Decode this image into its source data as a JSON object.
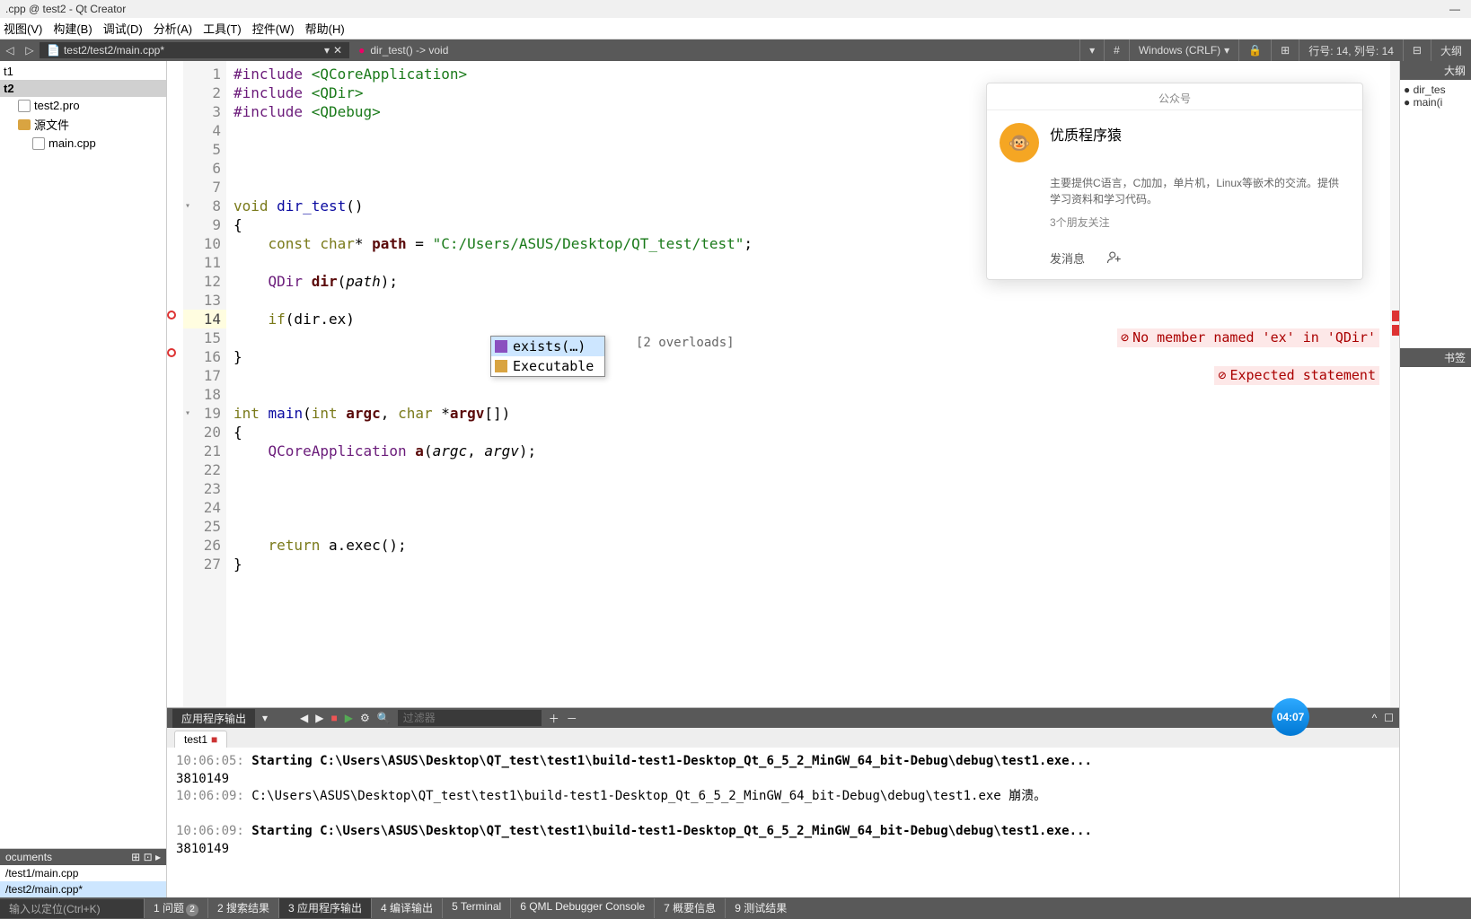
{
  "title": ".cpp @ test2 - Qt Creator",
  "menu": [
    "视图(V)",
    "构建(B)",
    "调试(D)",
    "分析(A)",
    "工具(T)",
    "控件(W)",
    "帮助(H)"
  ],
  "tab_path": "test2/test2/main.cpp*",
  "breadcrumb": "dir_test() -> void",
  "toolbar_status": {
    "encoding": "Windows (CRLF)",
    "pos": "行号: 14, 列号: 14",
    "outline_btn": "大纲"
  },
  "project_tree": [
    {
      "label": "t1",
      "indent": 0
    },
    {
      "label": "t2",
      "indent": 0,
      "bold": true,
      "sel": true
    },
    {
      "label": "test2.pro",
      "indent": 1,
      "icon": "file"
    },
    {
      "label": "源文件",
      "indent": 1,
      "icon": "folder"
    },
    {
      "label": "main.cpp",
      "indent": 2,
      "icon": "file"
    }
  ],
  "documents_header": "ocuments",
  "documents": [
    {
      "label": "/test1/main.cpp"
    },
    {
      "label": "/test2/main.cpp*",
      "sel": true
    }
  ],
  "code_lines": [
    {
      "n": 1,
      "html": "<span class='pp'>#include</span> <span class='inc'>&lt;QCoreApplication&gt;</span>"
    },
    {
      "n": 2,
      "html": "<span class='pp'>#include</span> <span class='inc'>&lt;QDir&gt;</span>"
    },
    {
      "n": 3,
      "html": "<span class='pp'>#include</span> <span class='inc'>&lt;QDebug&gt;</span>"
    },
    {
      "n": 4,
      "html": ""
    },
    {
      "n": 5,
      "html": ""
    },
    {
      "n": 6,
      "html": ""
    },
    {
      "n": 7,
      "html": ""
    },
    {
      "n": 8,
      "fold": true,
      "html": "<span class='kw'>void</span> <span class='fn'>dir_test</span>()"
    },
    {
      "n": 9,
      "html": "{"
    },
    {
      "n": 10,
      "html": "    <span class='kw'>const</span> <span class='kw'>char</span>* <span class='var'>path</span> = <span class='st'>\"C:/Users/ASUS/Desktop/QT_test/test\"</span>;"
    },
    {
      "n": 11,
      "html": ""
    },
    {
      "n": 12,
      "html": "    <span class='ty'>QDir</span> <span class='var'>dir</span>(<span class='it'>path</span>);"
    },
    {
      "n": 13,
      "html": ""
    },
    {
      "n": 14,
      "cur": true,
      "err": true,
      "html": "    <span class='kw'>if</span>(dir.ex)",
      "diag": "No member named 'ex' in 'QDir'"
    },
    {
      "n": 15,
      "html": ""
    },
    {
      "n": 16,
      "err": true,
      "html": "}",
      "diag": "Expected statement"
    },
    {
      "n": 17,
      "html": ""
    },
    {
      "n": 18,
      "html": ""
    },
    {
      "n": 19,
      "fold": true,
      "html": "<span class='kw'>int</span> <span class='fn'>main</span>(<span class='kw'>int</span> <span class='var'>argc</span>, <span class='kw'>char</span> *<span class='var'>argv</span>[])"
    },
    {
      "n": 20,
      "html": "{"
    },
    {
      "n": 21,
      "html": "    <span class='ty'>QCoreApplication</span> <span class='var'>a</span>(<span class='it'>argc</span>, <span class='it'>argv</span>);"
    },
    {
      "n": 22,
      "html": ""
    },
    {
      "n": 23,
      "html": ""
    },
    {
      "n": 24,
      "html": ""
    },
    {
      "n": 25,
      "html": ""
    },
    {
      "n": 26,
      "html": "    <span class='kw'>return</span> a.exec();"
    },
    {
      "n": 27,
      "html": "}"
    }
  ],
  "completion": {
    "items": [
      {
        "label": "exists(…)",
        "sel": true,
        "icon_color": "#8a4fbf"
      },
      {
        "label": "Executable",
        "icon_color": "#d9a441"
      }
    ],
    "hint": "[2 overloads]"
  },
  "outline_header": "大纲",
  "outline_items": [
    "dir_tes",
    "main(i"
  ],
  "bookmark_header": "书签",
  "card": {
    "hdr": "公众号",
    "title": "优质程序猿",
    "desc": "主要提供C语言，C加加，单片机，Linux等嵌术的交流。提供学习资料和学习代码。",
    "follow": "3个朋友关注",
    "btn1": "发消息"
  },
  "clock": "04:07",
  "bottom": {
    "title": "应用程序输出",
    "filter_ph": "过滤器",
    "tab": "test1",
    "lines": [
      {
        "html": "<span class='ts'>10:06:05: </span><span class='bold'>Starting C:\\Users\\ASUS\\Desktop\\QT_test\\test1\\build-test1-Desktop_Qt_6_5_2_MinGW_64_bit-Debug\\debug\\test1.exe...</span>"
      },
      {
        "html": "3810149"
      },
      {
        "html": "<span class='ts'>10:06:09: </span>C:\\Users\\ASUS\\Desktop\\QT_test\\test1\\build-test1-Desktop_Qt_6_5_2_MinGW_64_bit-Debug\\debug\\test1.exe 崩溃。"
      },
      {
        "html": ""
      },
      {
        "html": "<span class='ts'>10:06:09: </span><span class='bold'>Starting C:\\Users\\ASUS\\Desktop\\QT_test\\test1\\build-test1-Desktop_Qt_6_5_2_MinGW_64_bit-Debug\\debug\\test1.exe...</span>"
      },
      {
        "html": "3810149"
      }
    ]
  },
  "footer": {
    "locator_ph": "输入以定位(Ctrl+K)",
    "tabs": [
      {
        "n": "1",
        "label": "问题",
        "badge": "2"
      },
      {
        "n": "2",
        "label": "搜索结果"
      },
      {
        "n": "3",
        "label": "应用程序输出",
        "act": true
      },
      {
        "n": "4",
        "label": "编译输出"
      },
      {
        "n": "5",
        "label": "Terminal"
      },
      {
        "n": "6",
        "label": "QML Debugger Console"
      },
      {
        "n": "7",
        "label": "概要信息"
      },
      {
        "n": "9",
        "label": "测试结果"
      }
    ]
  }
}
